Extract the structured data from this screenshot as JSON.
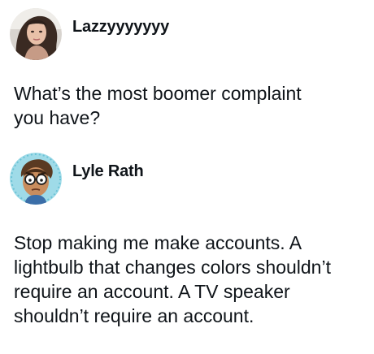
{
  "posts": [
    {
      "author": "Lazzyyyyyyy",
      "avatar_icon": "user-photo-avatar",
      "text": "What’s the most boomer complaint\nyou have?"
    },
    {
      "author": "Lyle Rath",
      "avatar_icon": "cartoon-face-avatar",
      "text": "Stop making me make accounts. A\nlightbulb that changes colors shouldn’t\nrequire an account. A TV speaker\nshouldn’t require an account."
    }
  ]
}
